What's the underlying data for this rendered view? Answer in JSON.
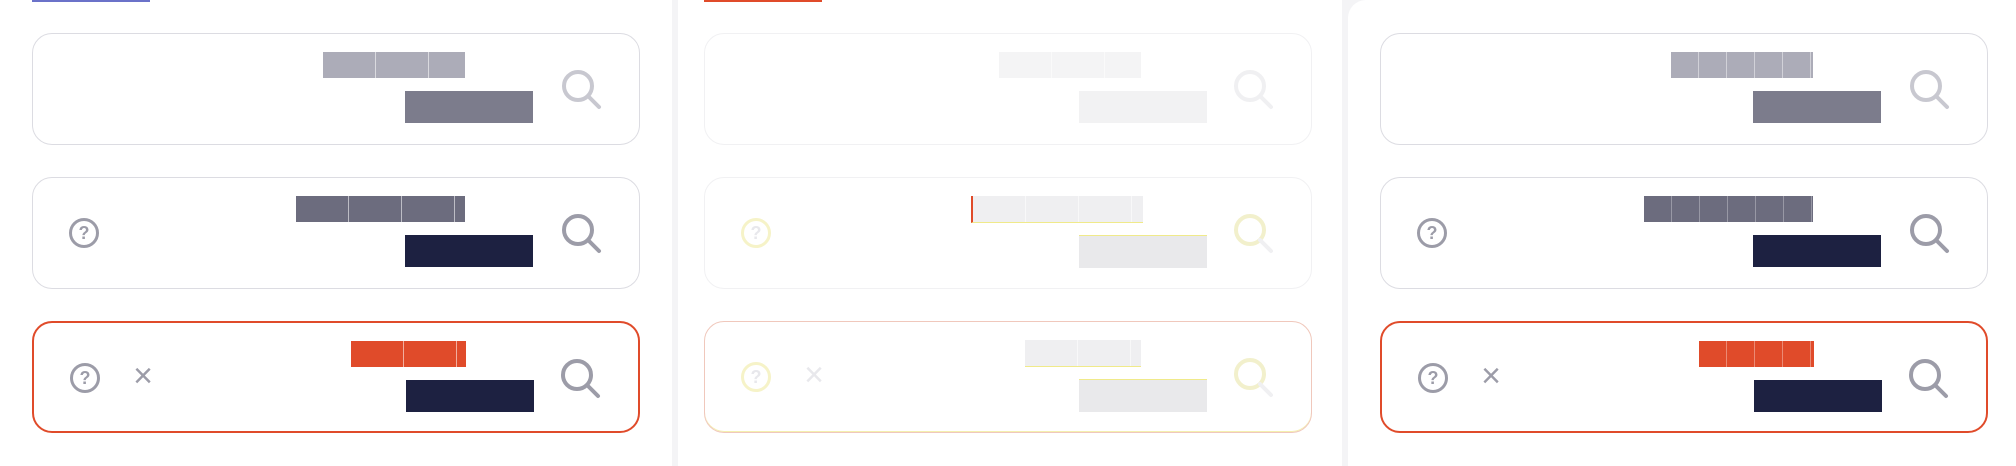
{
  "colors": {
    "accent_tab": "#6b72c9",
    "error": "#e04b2a",
    "label_light": "#acacb8",
    "label_dark": "#6c6c7e",
    "value_muted": "#7c7c8c",
    "value_dark": "#1d2141",
    "disabled": "#f2f2f4"
  },
  "icons": {
    "help": "question-circle",
    "clear": "x",
    "search": "magnifier"
  },
  "glyphs": {
    "help": "?",
    "clear": "×"
  },
  "variants": [
    "default",
    "focused",
    "error"
  ],
  "panels": [
    "enabled",
    "disabled",
    "enabled-wide"
  ]
}
